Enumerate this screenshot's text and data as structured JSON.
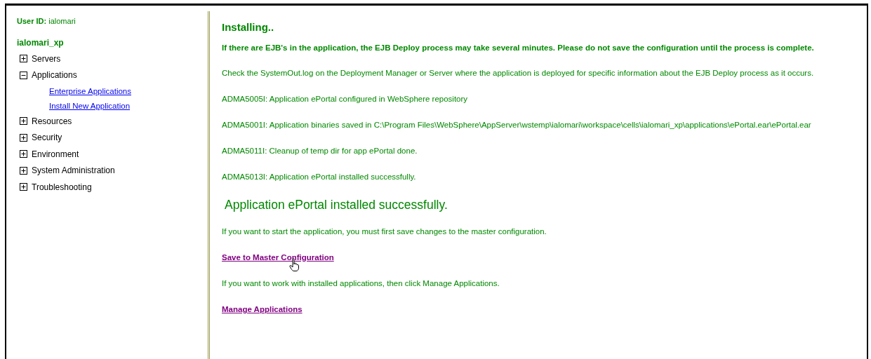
{
  "user": {
    "label": "User ID:",
    "value": "ialomari"
  },
  "cell": "ialomari_xp",
  "nav": [
    {
      "label": "Servers",
      "expanded": false
    },
    {
      "label": "Applications",
      "expanded": true,
      "children": [
        {
          "label": "Enterprise Applications"
        },
        {
          "label": "Install New Application"
        }
      ]
    },
    {
      "label": "Resources",
      "expanded": false
    },
    {
      "label": "Security",
      "expanded": false
    },
    {
      "label": "Environment",
      "expanded": false
    },
    {
      "label": "System Administration",
      "expanded": false
    },
    {
      "label": "Troubleshooting",
      "expanded": false
    }
  ],
  "content": [
    {
      "kind": "heading",
      "text": "Installing.."
    },
    {
      "kind": "warning",
      "text": "If there are EJB's in the application, the EJB Deploy process may take several minutes. Please do not save the configuration until the process is complete."
    },
    {
      "kind": "text",
      "text": "Check the SystemOut.log on the Deployment Manager or Server where the application is deployed for specific information about the EJB Deploy process as it occurs."
    },
    {
      "kind": "text",
      "text": "ADMA5005I: Application ePortal configured in WebSphere repository"
    },
    {
      "kind": "text",
      "text": "ADMA5001I: Application binaries saved in C:\\Program Files\\WebSphere\\AppServer\\wstemp\\ialomari\\workspace\\cells\\ialomari_xp\\applications\\ePortal.ear\\ePortal.ear"
    },
    {
      "kind": "text",
      "text": "ADMA5011I: Cleanup of temp dir for app ePortal done."
    },
    {
      "kind": "text",
      "text": "ADMA5013I: Application ePortal installed successfully."
    },
    {
      "kind": "big",
      "text": "Application ePortal installed successfully."
    },
    {
      "kind": "text",
      "text": "If you want to start the application, you must first save changes to the master configuration."
    },
    {
      "kind": "link",
      "text": "Save to Master Configuration",
      "hovered": true
    },
    {
      "kind": "text",
      "text": "If you want to work with installed applications, then click Manage Applications."
    },
    {
      "kind": "link",
      "text": "Manage Applications",
      "hovered": false
    }
  ]
}
